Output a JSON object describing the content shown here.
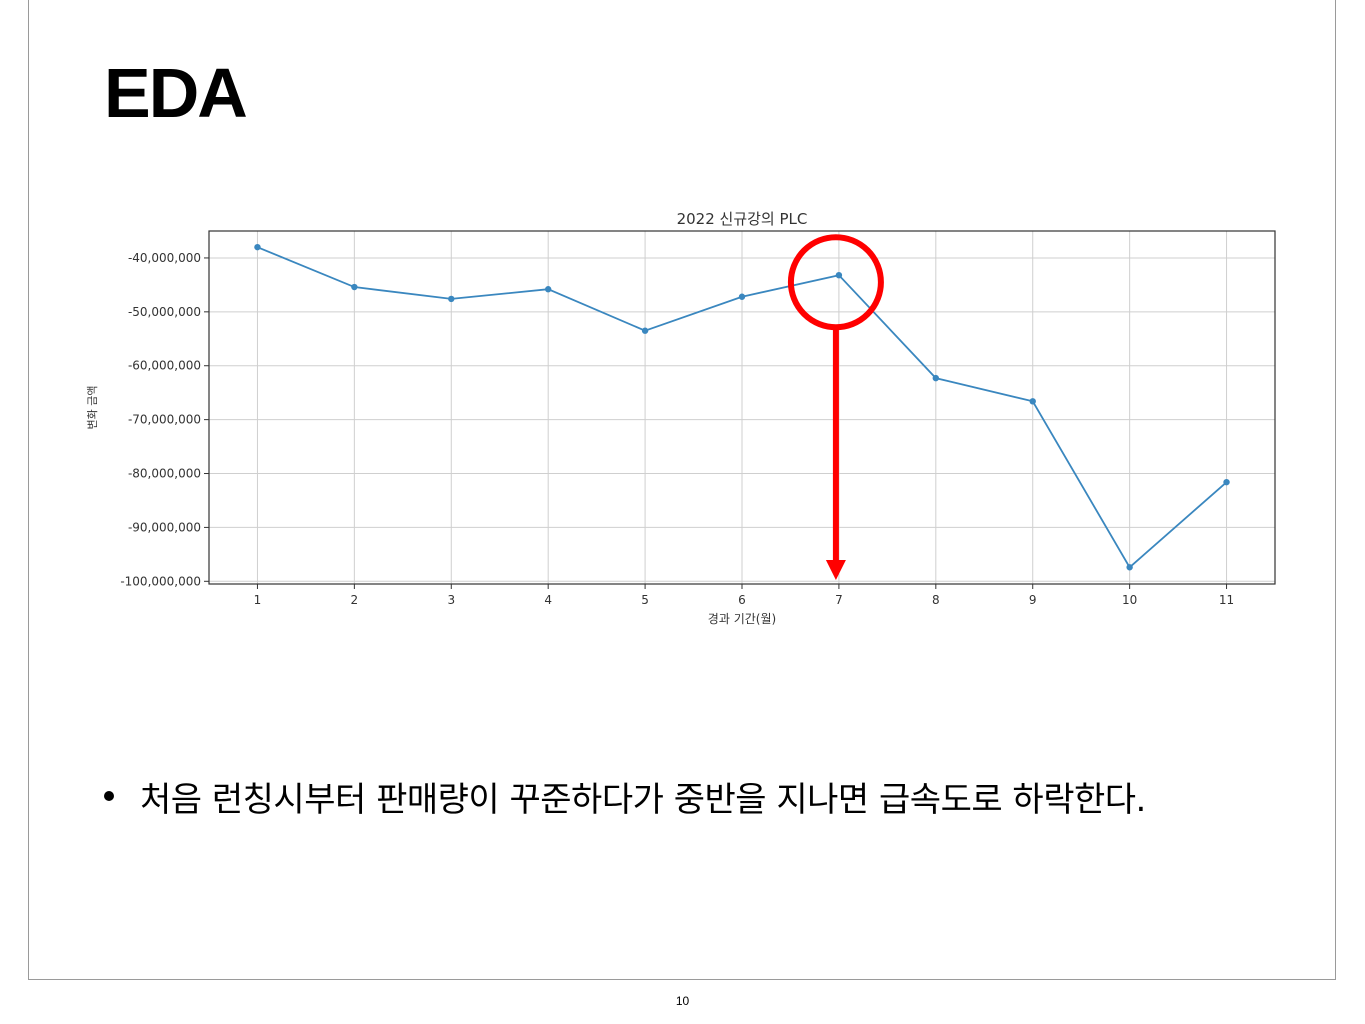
{
  "slide": {
    "title": "EDA",
    "bullet": "처음 런칭시부터 판매량이 꾸준하다가 중반을 지나면 급속도로 하락한다.",
    "page_number": "10"
  },
  "chart_data": {
    "type": "line",
    "title": "2022 신규강의 PLC",
    "xlabel": "경과 기간(월)",
    "ylabel": "변화 금액",
    "x": [
      1,
      2,
      3,
      4,
      5,
      6,
      7,
      8,
      9,
      10,
      11
    ],
    "series": [
      {
        "values": [
          -38000000,
          -45400000,
          -47600000,
          -45800000,
          -53500000,
          -47200000,
          -43200000,
          -62300000,
          -66600000,
          -97400000,
          -81600000
        ]
      }
    ],
    "xlim": [
      0.5,
      11.5
    ],
    "ylim": [
      -100500000,
      -35000000
    ],
    "yticks": [
      -40000000,
      -50000000,
      -60000000,
      -70000000,
      -80000000,
      -90000000,
      -100000000
    ],
    "ytick_labels": [
      "-40,000,000",
      "-50,000,000",
      "-60,000,000",
      "-70,000,000",
      "-80,000,000",
      "-90,000,000",
      "-100,000,000"
    ],
    "xtick_labels": [
      "1",
      "2",
      "3",
      "4",
      "5",
      "6",
      "7",
      "8",
      "9",
      "10",
      "11"
    ],
    "grid": true,
    "colors": {
      "line": "#3a87bf",
      "annotation": "#ff0000"
    },
    "annotation": {
      "type": "circle-with-down-arrow",
      "highlight_x": 7
    }
  }
}
